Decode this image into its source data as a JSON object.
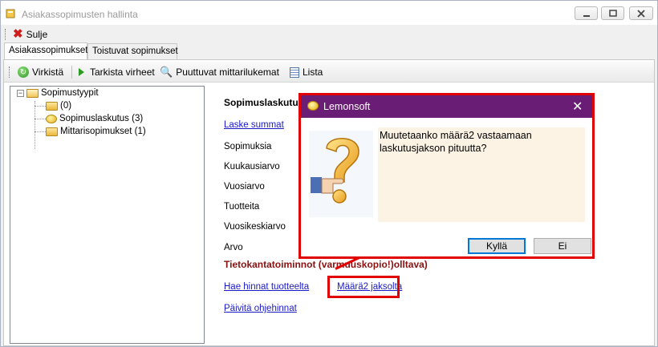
{
  "window": {
    "title": "Asiakassopimusten hallinta"
  },
  "toolbar": {
    "close_label": "Sulje"
  },
  "tabs": [
    {
      "label": "Asiakassopimukset",
      "active": true
    },
    {
      "label": "Toistuvat sopimukset",
      "active": false
    }
  ],
  "toolbar2": {
    "refresh_label": "Virkistä",
    "check_errors_label": "Tarkista virheet",
    "missing_meter_label": "Puuttuvat mittarilukemat",
    "list_label": "Lista"
  },
  "tree": {
    "root": "Sopimustyypit",
    "children": [
      "(0)",
      "Sopimuslaskutus (3)",
      "Mittarisopimukset (1)"
    ]
  },
  "content": {
    "section1_title": "Sopimuslaskutus",
    "calc_link": "Laske summat",
    "labels": [
      "Sopimuksia",
      "Kuukausiarvo",
      "Vuosiarvo",
      "Tuotteita",
      "Vuosikeskiarvo",
      "Arvo"
    ],
    "section2_title": "Tietokantatoiminnot (varmuuskopio!)olltava)",
    "fetch_prices_link": "Hae hinnat tuotteelta",
    "qty2_link": "Määrä2 jaksolta",
    "update_prices_link": "Päivitä ohjehinnat"
  },
  "dialog": {
    "title": "Lemonsoft",
    "message": "Muutetaanko määrä2 vastaamaan laskutusjakson pituutta?",
    "yes_label": "Kyllä",
    "no_label": "Ei"
  },
  "colors": {
    "dialog_title_bg": "#6a1d74",
    "highlight": "#e00000",
    "link": "#1a1ac8",
    "section2_title": "#8b1010"
  },
  "icons": [
    "app-icon",
    "close-x-icon",
    "refresh-icon",
    "play-icon",
    "magnifier-icon",
    "list-icon",
    "folder-icon",
    "coin-icon",
    "question-hand-icon"
  ]
}
